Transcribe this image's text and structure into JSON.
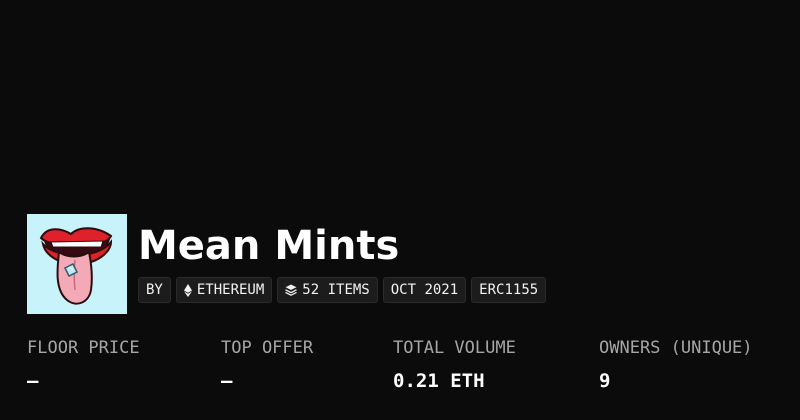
{
  "collection": {
    "title": "Mean Mints",
    "avatar_icon": "tongue-gem-icon",
    "avatar_bg": "#c9f3fb"
  },
  "badges": {
    "by": "BY",
    "chain": "ETHEREUM",
    "chain_icon": "ethereum-icon",
    "items": "52 ITEMS",
    "items_icon": "layers-icon",
    "date": "OCT 2021",
    "standard": "ERC1155"
  },
  "stats": [
    {
      "label": "FLOOR PRICE",
      "value": "—"
    },
    {
      "label": "TOP OFFER",
      "value": "—"
    },
    {
      "label": "TOTAL VOLUME",
      "value": "0.21 ETH"
    },
    {
      "label": "OWNERS (UNIQUE)",
      "value": "9"
    }
  ]
}
